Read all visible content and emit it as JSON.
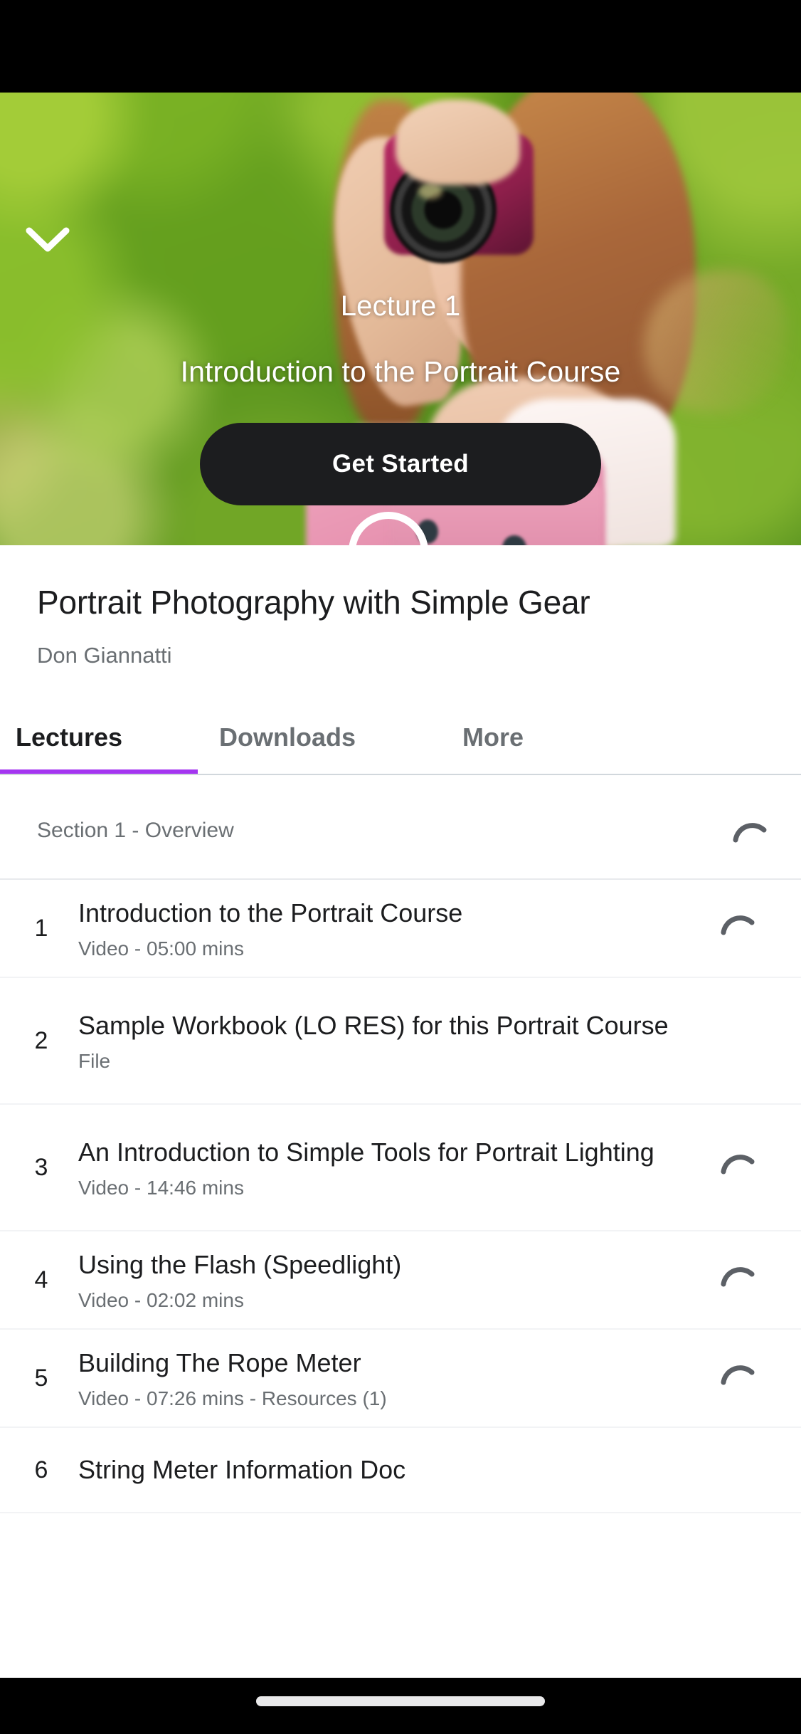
{
  "colors": {
    "accent_purple": "#a435f0",
    "dark": "#1c1d1f",
    "muted_text": "#6a6f73",
    "sheet_bg": "#ffffff",
    "status_bar": "#000000"
  },
  "hero": {
    "collapse_icon": "chevron-down-icon",
    "lecture_label": "Lecture 1",
    "lecture_title": "Introduction to the Portrait Course",
    "cta_label": "Get Started",
    "progress_ring_icon": "progress-ring-icon"
  },
  "course": {
    "title": "Portrait Photography with Simple Gear",
    "author": "Don Giannatti"
  },
  "tabs": [
    {
      "label": "Lectures",
      "active": true
    },
    {
      "label": "Downloads",
      "active": false
    },
    {
      "label": "More",
      "active": false
    }
  ],
  "section": {
    "label": "Section 1 - Overview",
    "status_icon": "loading-spinner-icon"
  },
  "lectures": [
    {
      "number": "1",
      "title": "Introduction to the Portrait Course",
      "meta": "Video - 05:00 mins",
      "status_icon": "loading-spinner-icon",
      "has_status": true
    },
    {
      "number": "2",
      "title": "Sample Workbook (LO RES) for this Portrait Course",
      "meta": "File",
      "status_icon": "",
      "has_status": false
    },
    {
      "number": "3",
      "title": "An Introduction to Simple Tools for Portrait Lighting",
      "meta": "Video - 14:46 mins",
      "status_icon": "loading-spinner-icon",
      "has_status": true
    },
    {
      "number": "4",
      "title": "Using the Flash (Speedlight)",
      "meta": "Video - 02:02 mins",
      "status_icon": "loading-spinner-icon",
      "has_status": true
    },
    {
      "number": "5",
      "title": "Building The Rope Meter",
      "meta": "Video - 07:26 mins - Resources (1)",
      "status_icon": "loading-spinner-icon",
      "has_status": true
    },
    {
      "number": "6",
      "title": "String Meter Information Doc",
      "meta": "",
      "status_icon": "",
      "has_status": false
    }
  ],
  "system_bar": {
    "home_indicator": "home-indicator"
  }
}
